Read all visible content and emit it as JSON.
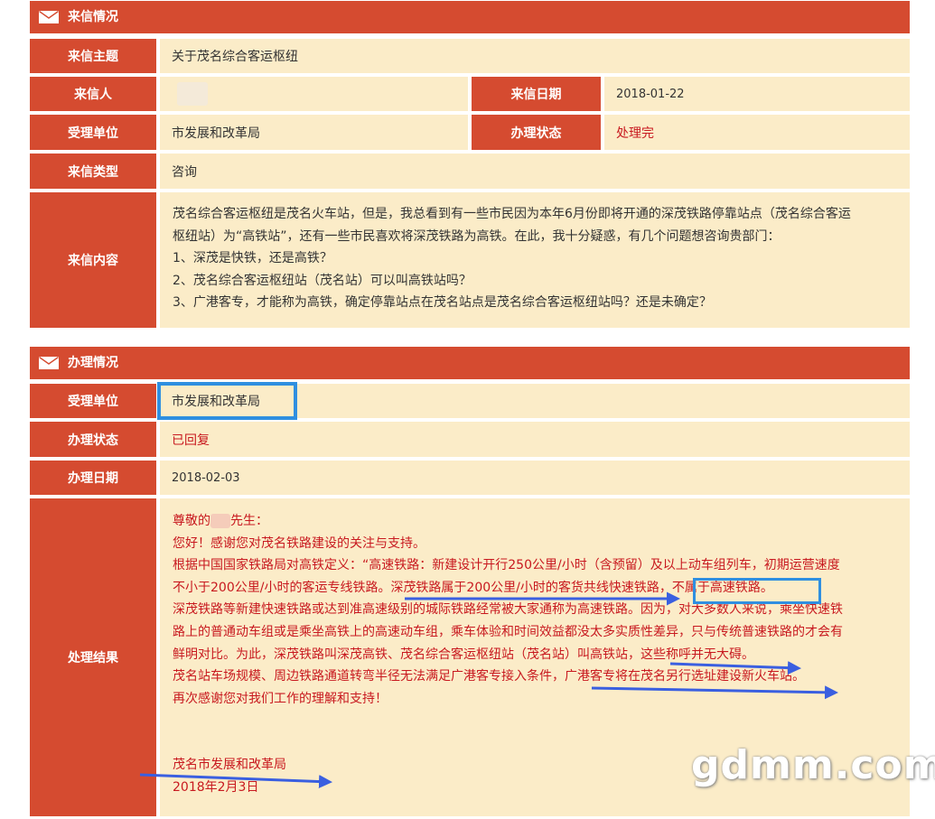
{
  "letter_section": {
    "title": "来信情况",
    "subject_label": "来信主题",
    "subject_value": "关于茂名综合客运枢纽",
    "sender_label": "来信人",
    "date_label": "来信日期",
    "date_value": "2018-01-22",
    "unit_label": "受理单位",
    "unit_value": "市发展和改革局",
    "status_label": "办理状态",
    "status_value": "处理完",
    "type_label": "来信类型",
    "type_value": "咨询",
    "content_label": "来信内容",
    "content_lines": [
      "茂名综合客运枢纽是茂名火车站，但是，我总看到有一些市民因为本年6月份即将开通的深茂铁路停靠站点（茂名综合客运",
      "枢纽站）为“高铁站”，还有一些市民喜欢将深茂铁路为高铁。在此，我十分疑惑，有几个问题想咨询贵部门：",
      "1、深茂是快铁，还是高铁？",
      "2、茂名综合客运枢纽站（茂名站）可以叫高铁站吗？",
      "3、广港客专，才能称为高铁，确定停靠站点在茂名站点是茂名综合客运枢纽站吗？还是未确定？"
    ]
  },
  "handling_section": {
    "title": "办理情况",
    "unit_label": "受理单位",
    "unit_value": "市发展和改革局",
    "status_label": "办理状态",
    "status_value": "已回复",
    "date_label": "办理日期",
    "date_value": "2018-02-03",
    "result_label": "处理结果",
    "greeting_prefix": "尊敬的",
    "greeting_suffix": "先生：",
    "result_lines": [
      "您好！感谢您对茂名铁路建设的关注与支持。",
      "根据中国国家铁路局对高铁定义：“高速铁路：新建设计开行250公里/小时（含预留）及以上动车组列车，初期运营速度",
      "不小于200公里/小时的客运专线铁路。深茂铁路属于200公里/小时的客货共线快速铁路，不属于高速铁路。",
      "深茂铁路等新建快速铁路或达到准高速级别的城际铁路经常被大家通称为高速铁路。因为，对大多数人来说，乘坐快速铁",
      "路上的普通动车组或是乘坐高铁上的高速动车组，乘车体验和时间效益都没太多实质性差异，只与传统普速铁路的才会有",
      "鲜明对比。为此，深茂铁路叫深茂高铁、茂名综合客运枢纽站（茂名站）叫高铁站，这些称呼并无大碍。",
      "茂名站车场规模、周边铁路通道转弯半径无法满足广港客专接入条件，广港客专将在茂名另行选址建设新火车站。",
      "再次感谢您对我们工作的理解和支持！"
    ],
    "signature": "茂名市发展和改革局",
    "signature_date": "2018年2月3日"
  },
  "watermark": "gdmm.com",
  "colors": {
    "header_red": "#d54b30",
    "cell_bg": "#fbecc8",
    "status_red": "#c8191f",
    "highlight_blue": "#2f8fe0",
    "arrow_blue": "#3a5fe0"
  }
}
